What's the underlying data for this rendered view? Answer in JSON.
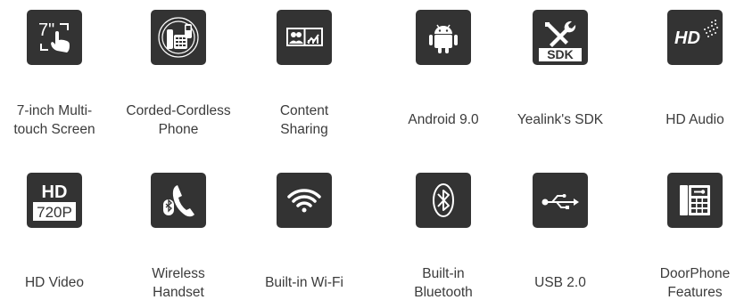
{
  "features": [
    {
      "label": "7-inch Multi-\ntouch Screen",
      "icon": "touch-screen-icon"
    },
    {
      "label": "Corded-Cordless\nPhone",
      "icon": "corded-cordless-phone-icon"
    },
    {
      "label": "Content\nSharing",
      "icon": "content-sharing-icon"
    },
    {
      "label": "Android 9.0",
      "icon": "android-icon"
    },
    {
      "label": "Yealink's SDK",
      "icon": "sdk-icon"
    },
    {
      "label": "HD Audio",
      "icon": "hd-audio-icon"
    },
    {
      "label": "HD Video",
      "icon": "hd-video-icon"
    },
    {
      "label": "Wireless\nHandset",
      "icon": "bluetooth-handset-icon"
    },
    {
      "label": "Built-in Wi-Fi",
      "icon": "wifi-icon"
    },
    {
      "label": "Built-in\nBluetooth",
      "icon": "bluetooth-icon"
    },
    {
      "label": "USB 2.0",
      "icon": "usb-icon"
    },
    {
      "label": "DoorPhone\nFeatures",
      "icon": "doorphone-icon"
    }
  ],
  "icon_text": {
    "screen_size": "7\"",
    "sdk": "SDK",
    "hd": "HD",
    "resolution": "720P"
  },
  "colors": {
    "tile": "#333333",
    "glyph": "#ffffff",
    "text": "#3b3b3b"
  }
}
